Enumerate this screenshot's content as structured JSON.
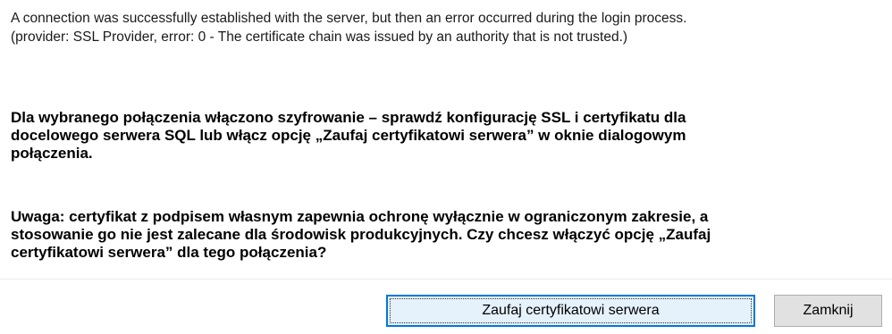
{
  "error": {
    "line1": "A connection was successfully established with the server, but then an error occurred during the login process.",
    "line2": "(provider: SSL Provider, error: 0 - The certificate chain was issued by an authority that is not trusted.)"
  },
  "encryption_message": {
    "line1": "Dla wybranego połączenia włączono szyfrowanie – sprawdź konfigurację SSL i certyfikatu dla",
    "line2": "docelowego serwera SQL lub włącz opcję „Zaufaj certyfikatowi serwera” w oknie dialogowym",
    "line3": "połączenia."
  },
  "warning_message": {
    "line1": "Uwaga: certyfikat z podpisem własnym zapewnia ochronę wyłącznie w ograniczonym zakresie, a",
    "line2": "stosowanie go nie jest zalecane dla środowisk produkcyjnych. Czy chcesz włączyć opcję „Zaufaj",
    "line3": "certyfikatowi serwera” dla tego połączenia?"
  },
  "buttons": {
    "trust_label": "Zaufaj certyfikatowi serwera",
    "close_label": "Zamknij"
  },
  "colors": {
    "default_button_border": "#0078d7",
    "default_button_background": "#e5f1fb",
    "button_background": "#e1e1e1"
  }
}
